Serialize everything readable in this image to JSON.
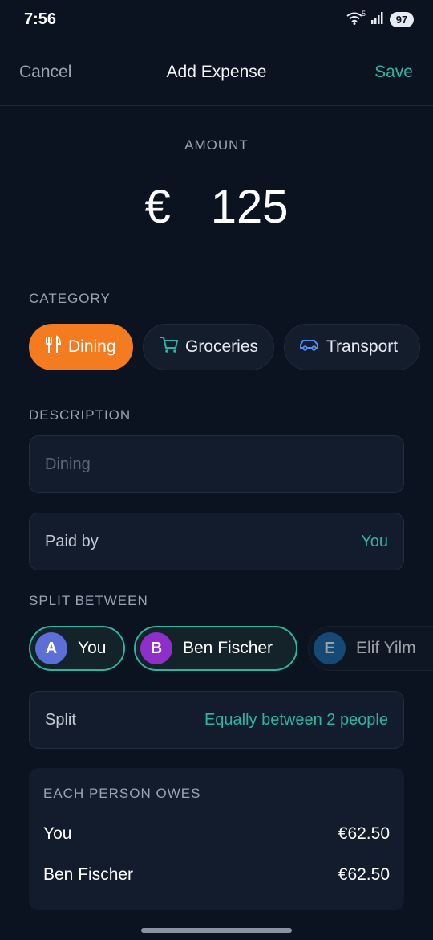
{
  "status_bar": {
    "time": "7:56",
    "wifi_badge": "5",
    "battery": "97"
  },
  "header": {
    "cancel_label": "Cancel",
    "title": "Add Expense",
    "save_label": "Save"
  },
  "amount": {
    "label": "AMOUNT",
    "currency": "€",
    "value": "125"
  },
  "category": {
    "label": "CATEGORY",
    "items": [
      {
        "label": "Dining",
        "icon": "fork-knife-icon",
        "selected": true
      },
      {
        "label": "Groceries",
        "icon": "cart-icon",
        "selected": false
      },
      {
        "label": "Transport",
        "icon": "car-icon",
        "selected": false
      }
    ]
  },
  "description": {
    "label": "DESCRIPTION",
    "placeholder": "Dining",
    "value": ""
  },
  "paid_by": {
    "label": "Paid by",
    "value": "You"
  },
  "split_between": {
    "label": "SPLIT BETWEEN",
    "people": [
      {
        "initial": "A",
        "name": "You",
        "avatar_color": "#5b6fd6",
        "selected": true
      },
      {
        "initial": "B",
        "name": "Ben Fischer",
        "avatar_color": "#8e2fc9",
        "selected": true
      },
      {
        "initial": "E",
        "name": "Elif Yilm",
        "avatar_color": "#1f6fb0",
        "selected": false
      }
    ]
  },
  "split": {
    "label": "Split",
    "value": "Equally between 2 people"
  },
  "owes": {
    "title": "EACH PERSON OWES",
    "rows": [
      {
        "name": "You",
        "amount": "€62.50"
      },
      {
        "name": "Ben Fischer",
        "amount": "€62.50"
      }
    ]
  },
  "colors": {
    "accent": "#2bb5a3",
    "selected_category": "#f47b20",
    "background": "#0b1220"
  }
}
